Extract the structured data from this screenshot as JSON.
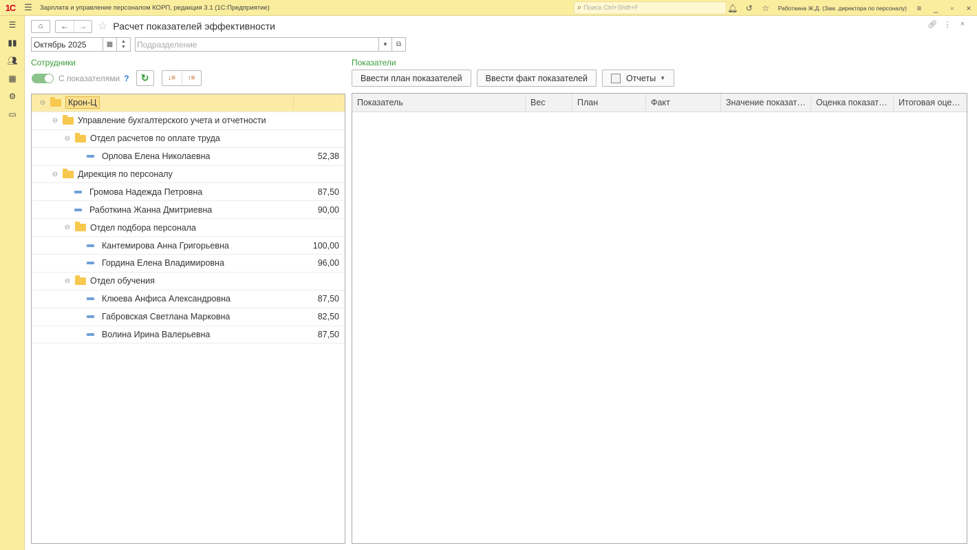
{
  "app": {
    "title": "Зарплата и управление персоналом КОРП, редакция 3.1  (1С:Предприятие)",
    "logo": "1С",
    "search_placeholder": "Поиск Ctrl+Shift+F",
    "user": "Работкина Ж.Д. (Зам. директора по персоналу)"
  },
  "page": {
    "title": "Расчет показателей эффективности",
    "period": "Октябрь 2025",
    "division_placeholder": "Подразделение"
  },
  "employees": {
    "section_label": "Сотрудники",
    "toggle_label": "С показателями",
    "help_label": "?",
    "tree": [
      {
        "label": "Крон-Ц",
        "value": "",
        "type": "folder",
        "level": 0,
        "selected": true
      },
      {
        "label": "Управление бухгалтерского учета и отчетности",
        "value": "",
        "type": "folder",
        "level": 1
      },
      {
        "label": "Отдел расчетов по оплате труда",
        "value": "",
        "type": "folder",
        "level": 2
      },
      {
        "label": "Орлова Елена Николаевна",
        "value": "52,38",
        "type": "employee",
        "level": 3
      },
      {
        "label": "Дирекция по персоналу",
        "value": "",
        "type": "folder",
        "level": 1
      },
      {
        "label": "Громова Надежда Петровна",
        "value": "87,50",
        "type": "employee",
        "level": 2
      },
      {
        "label": "Работкина Жанна Дмитриевна",
        "value": "90,00",
        "type": "employee",
        "level": 2
      },
      {
        "label": "Отдел подбора персонала",
        "value": "",
        "type": "folder",
        "level": 2
      },
      {
        "label": "Кантемирова Анна Григорьевна",
        "value": "100,00",
        "type": "employee",
        "level": 3
      },
      {
        "label": "Гордина Елена Владимировна",
        "value": "96,00",
        "type": "employee",
        "level": 3
      },
      {
        "label": "Отдел обучения",
        "value": "",
        "type": "folder",
        "level": 2
      },
      {
        "label": "Клюева Анфиса Александровна",
        "value": "87,50",
        "type": "employee",
        "level": 3
      },
      {
        "label": "Габровская Светлана Марковна",
        "value": "82,50",
        "type": "employee",
        "level": 3
      },
      {
        "label": "Волина Ирина Валерьевна",
        "value": "87,50",
        "type": "employee",
        "level": 3
      }
    ]
  },
  "indicators": {
    "section_label": "Показатели",
    "buttons": {
      "plan": "Ввести план показателей",
      "fact": "Ввести факт показателей",
      "reports": "Отчеты"
    },
    "columns": [
      "Показатель",
      "Вес",
      "План",
      "Факт",
      "Значение показат…",
      "Оценка показат…",
      "Итоговая оце…"
    ]
  }
}
